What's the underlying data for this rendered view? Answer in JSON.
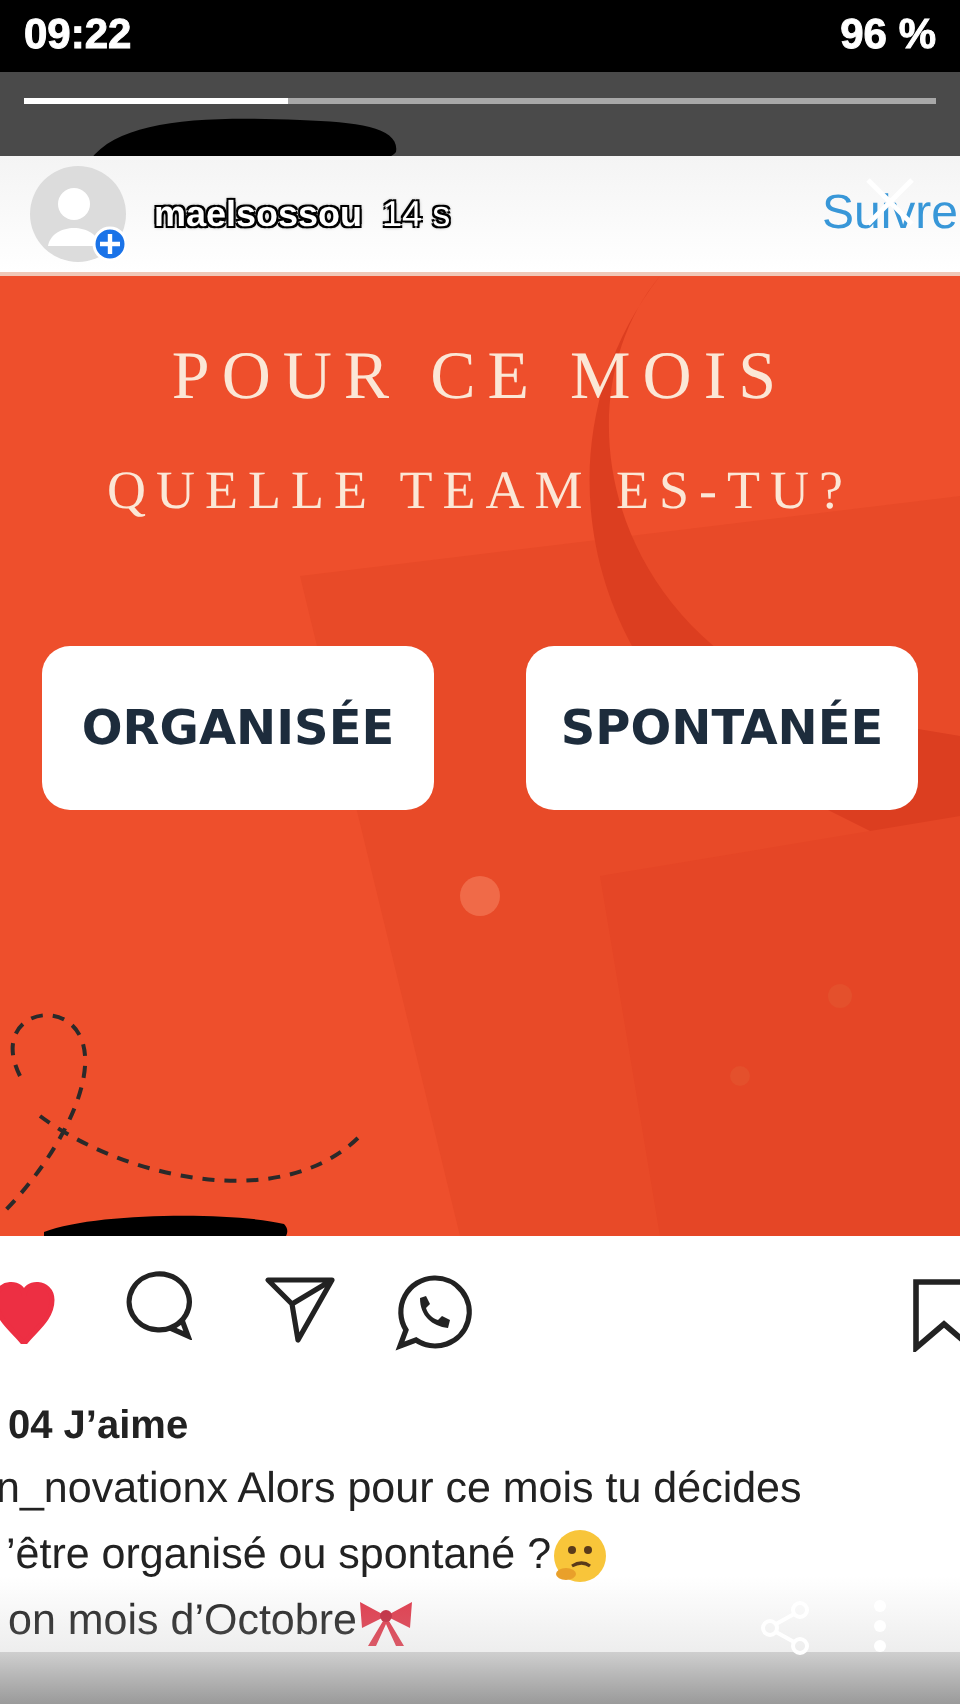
{
  "status_bar": {
    "time": "09:22",
    "battery": "96 %"
  },
  "story": {
    "progress": {
      "level": 0.29
    },
    "username": "maelsossou",
    "age": "14 s"
  },
  "post": {
    "follow_button": "Suivre",
    "image": {
      "title_lines": [
        "POUR CE MOIS",
        "QUELLE TEAM ES-TU?"
      ],
      "options": [
        "ORGANISÉE",
        "SPONTANÉE"
      ]
    },
    "actions": {
      "liked": true
    },
    "likes": "04 J’aime",
    "caption_lines": [
      "n_novationx Alors pour ce mois tu décides",
      "’être organisé ou spontané ?",
      "on mois d’Octobre"
    ]
  }
}
